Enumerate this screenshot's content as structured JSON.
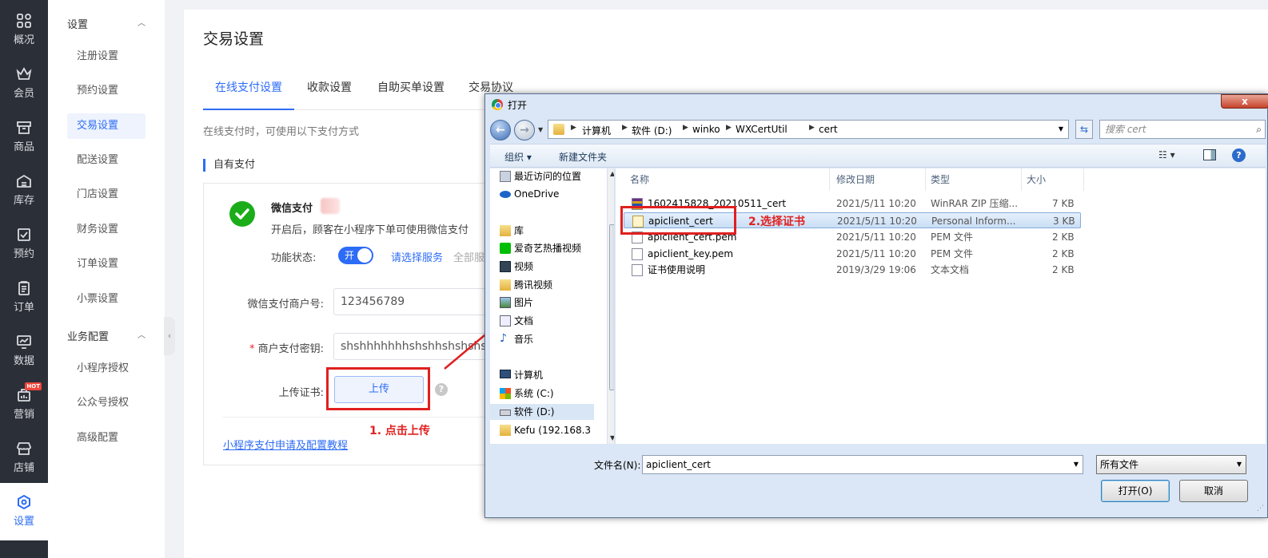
{
  "nav": {
    "items": [
      {
        "label": "概况",
        "icon": "grid-icon"
      },
      {
        "label": "会员",
        "icon": "crown-icon"
      },
      {
        "label": "商品",
        "icon": "store-box-icon"
      },
      {
        "label": "库存",
        "icon": "inventory-icon"
      },
      {
        "label": "预约",
        "icon": "calendar-check-icon"
      },
      {
        "label": "订单",
        "icon": "order-list-icon"
      },
      {
        "label": "数据",
        "icon": "chart-icon"
      },
      {
        "label": "营销",
        "icon": "marketing-icon",
        "badge": "HOT"
      },
      {
        "label": "店铺",
        "icon": "shop-icon"
      },
      {
        "label": "设置",
        "icon": "gear-icon",
        "active": true
      }
    ]
  },
  "subnav": {
    "group1": "设置",
    "group1_items": [
      "注册设置",
      "预约设置",
      "交易设置",
      "配送设置",
      "门店设置",
      "财务设置",
      "订单设置",
      "小票设置"
    ],
    "group2": "业务配置",
    "group2_items": [
      "小程序授权",
      "公众号授权",
      "高级配置"
    ],
    "active": "交易设置",
    "collapse_glyph": "‹"
  },
  "main": {
    "title": "交易设置",
    "tabs": [
      "在线支付设置",
      "收款设置",
      "自助买单设置",
      "交易协议"
    ],
    "tab_hint": "在线支付时，可使用以下支付方式",
    "section_title": "自有支付",
    "wechat": {
      "name": "微信支付",
      "desc": "开启后，顾客在小程序下单可使用微信支付",
      "status_label": "功能状态:",
      "switch_text": "开",
      "select_service": "请选择服务",
      "all_service": "全部服",
      "merchant_label": "微信支付商户号:",
      "merchant_value": "123456789",
      "key_required": "*",
      "key_label": "商户支付密钥:",
      "key_value": "shshhhhhhhshshhshshshsh",
      "cert_label": "上传证书:",
      "upload_button": "上传",
      "help": "?",
      "tutorial_link": "小程序支付申请及配置教程"
    }
  },
  "annotations": {
    "step1": "1. 点击上传",
    "step2": "2.选择证书",
    "color": "#e02020"
  },
  "dialog": {
    "title": "打开",
    "close_glyph": "x",
    "breadcrumb": [
      "计算机",
      "软件 (D:)",
      "winko",
      "WXCertUtil",
      "cert"
    ],
    "search_placeholder": "搜索 cert",
    "commands": {
      "organize": "组织 ▾",
      "new_folder": "新建文件夹"
    },
    "nav_items": [
      {
        "label": "最近访问的位置",
        "type": "item"
      },
      {
        "label": "OneDrive",
        "type": "item"
      },
      {
        "label": "库",
        "type": "header"
      },
      {
        "label": "爱奇艺热播视频",
        "type": "item"
      },
      {
        "label": "视频",
        "type": "item"
      },
      {
        "label": "腾讯视频",
        "type": "item"
      },
      {
        "label": "图片",
        "type": "item"
      },
      {
        "label": "文档",
        "type": "item"
      },
      {
        "label": "音乐",
        "type": "item"
      },
      {
        "label": "计算机",
        "type": "header"
      },
      {
        "label": "系统 (C:)",
        "type": "item"
      },
      {
        "label": "软件 (D:)",
        "type": "item",
        "selected": true
      },
      {
        "label": "Kefu (192.168.3",
        "type": "item"
      }
    ],
    "columns": [
      "名称",
      "修改日期",
      "类型",
      "大小"
    ],
    "files": [
      {
        "name": "1602415828_20210511_cert",
        "date": "2021/5/11 10:20",
        "type": "WinRAR ZIP 压缩...",
        "size": "7 KB",
        "kind": "zip"
      },
      {
        "name": "apiclient_cert",
        "date": "2021/5/11 10:20",
        "type": "Personal Inform...",
        "size": "3 KB",
        "kind": "cert",
        "selected": true
      },
      {
        "name": "apiclient_cert.pem",
        "date": "2021/5/11 10:20",
        "type": "PEM 文件",
        "size": "2 KB",
        "kind": "file"
      },
      {
        "name": "apiclient_key.pem",
        "date": "2021/5/11 10:20",
        "type": "PEM 文件",
        "size": "2 KB",
        "kind": "file"
      },
      {
        "name": "证书使用说明",
        "date": "2019/3/29 19:06",
        "type": "文本文档",
        "size": "2 KB",
        "kind": "file"
      }
    ],
    "filename_label": "文件名(N):",
    "filename_value": "apiclient_cert",
    "filetype_value": "所有文件",
    "open_button": "打开(O)",
    "cancel_button": "取消"
  },
  "colors": {
    "accent": "#2d6cf6",
    "nav_bg": "#2b2f38",
    "wechat": "#1aad19"
  }
}
